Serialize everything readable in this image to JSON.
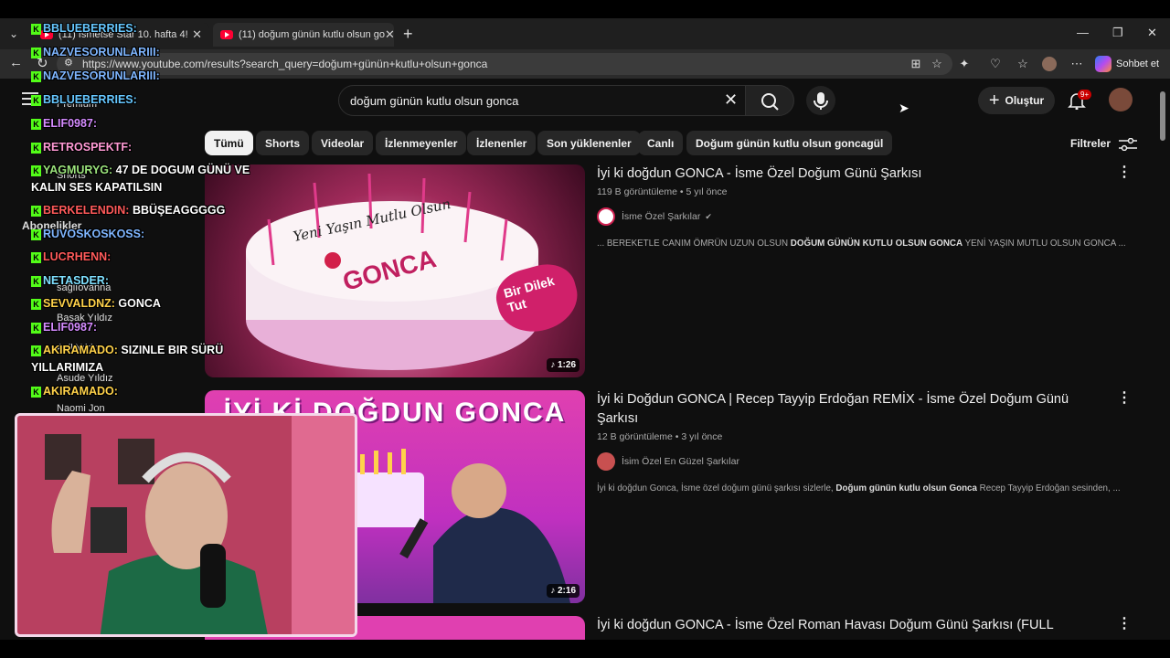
{
  "browser": {
    "tabs": [
      {
        "label": "(11) İsmetse Star 10. hafta 4!"
      },
      {
        "label": "(11) doğum günün kutlu olsun go"
      }
    ],
    "url": "https://www.youtube.com/results?search_query=doğum+günün+kutlu+olsun+gonca",
    "chat_label": "Sohbet et"
  },
  "youtube": {
    "search_value": "doğum günün kutlu olsun gonca",
    "create_label": "Oluştur",
    "notification_badge": "9+",
    "chips": [
      "Tümü",
      "Shorts",
      "Videolar",
      "İzlenmeyenler",
      "İzlenenler",
      "Son yüklenenler",
      "Canlı",
      "Doğum günün kutlu olsun goncagül"
    ],
    "filters_label": "Filtreler",
    "sidebar": {
      "shorts": "Shorts",
      "subscriptions": "Abonelikler",
      "channels": [
        "Premium",
        "sağlıovanna",
        "Başak Yıldız",
        "Acil Yıldız",
        "Asude Yıldız",
        "Naomi Jon"
      ]
    },
    "results": [
      {
        "title": "İyi ki doğdun GONCA - İsme Özel Doğum Günü Şarkısı",
        "views": "119 B görüntüleme",
        "age": "5 yıl önce",
        "channel": "İsme Özel Şarkılar",
        "duration": "1:26",
        "desc_pre": "... BEREKETLE CANIM ÖMRÜN UZUN OLSUN ",
        "desc_bold": "DOĞUM GÜNÜN KUTLU OLSUN GONCA",
        "desc_post": " YENİ YAŞIN MUTLU OLSUN GONCA ...",
        "thumb_cake_text": "Yeni Yaşın Mutlu Olsun",
        "thumb_name": "GONCA",
        "thumb_heart_text": "Bir Dilek Tut"
      },
      {
        "title": "İyi ki Doğdun GONCA | Recep Tayyip Erdoğan REMİX - İsme Özel Doğum Günü Şarkısı",
        "views": "12 B görüntüleme",
        "age": "3 yıl önce",
        "channel": "İsim Özel En Güzel Şarkılar",
        "duration": "2:16",
        "desc_pre": "İyi ki doğdun Gonca, İsme özel doğum günü şarkısı sizlerle, ",
        "desc_bold": "Doğum günün kutlu olsun Gonca",
        "desc_post": " Recep Tayyip Erdoğan sesinden, ...",
        "thumb_banner": "İYİ Kİ DOĞDUN GONCA"
      },
      {
        "title": "İyi ki doğdun GONCA - İsme Özel Roman Havası Doğum Günü Şarkısı (FULL"
      }
    ]
  },
  "chat": [
    {
      "user": "BBLUEBERRIES:",
      "msg": "",
      "color": "#66c7ff"
    },
    {
      "user": "NAZVESORUNLARIII:",
      "msg": "",
      "color": "#7fb6ff"
    },
    {
      "user": "NAZVESORUNLARIII:",
      "msg": "",
      "color": "#7fb6ff"
    },
    {
      "user": "BBLUEBERRIES:",
      "msg": "",
      "color": "#66c7ff"
    },
    {
      "user": "ELIF0987:",
      "msg": "",
      "color": "#d58cff"
    },
    {
      "user": "RETROSPEKTF:",
      "msg": "",
      "color": "#ff9ad5"
    },
    {
      "user": "YAGMURYG:",
      "msg": "47 DE DOGUM GÜNÜ VE",
      "color": "#9be37c"
    },
    {
      "user": "",
      "msg": "KALIN SES KAPATILSIN",
      "color": "#fff"
    },
    {
      "user": "BERKELENDIN:",
      "msg": "BBÜŞEAGGGGG",
      "color": "#ff5a5a"
    },
    {
      "user": "RUVOSKOSKOSS:",
      "msg": "",
      "color": "#7fb6ff"
    },
    {
      "user": "LUCRHENN:",
      "msg": "",
      "color": "#ff5a5a"
    },
    {
      "user": "NETASDER:",
      "msg": "",
      "color": "#7fe0ff"
    },
    {
      "user": "SEVVALDNZ:",
      "msg": "GONCA",
      "color": "#ffd24a"
    },
    {
      "user": "ELIF0987:",
      "msg": "",
      "color": "#d58cff"
    },
    {
      "user": "AKIRAMADO:",
      "msg": "SIZINLE BIR SÜRÜ",
      "color": "#ffd24a"
    },
    {
      "user": "",
      "msg": "YILLARIMIZA",
      "color": "#fff"
    },
    {
      "user": "AKIRAMADO:",
      "msg": "",
      "color": "#ffd24a"
    }
  ]
}
